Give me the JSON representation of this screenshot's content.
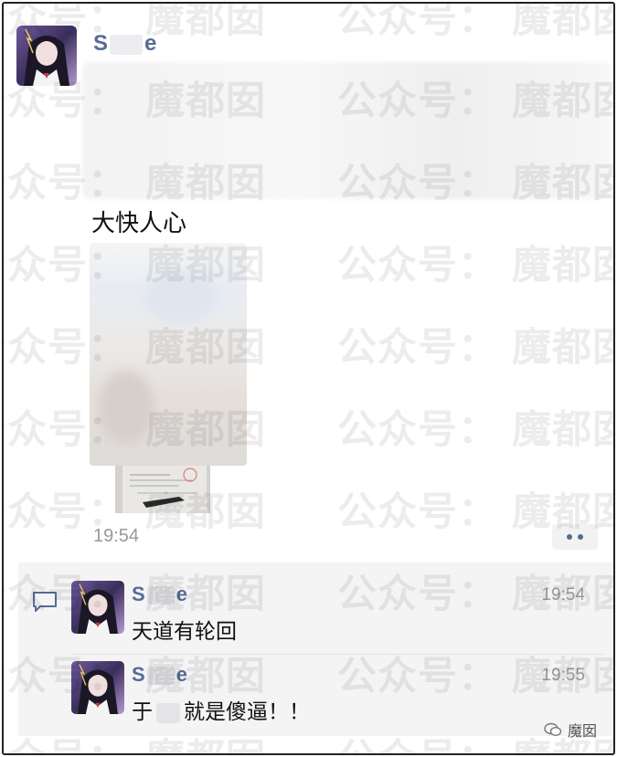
{
  "post": {
    "author_prefix": "S",
    "author_suffix": "e",
    "text": "大快人心",
    "time": "19:54",
    "more_icon": "ellipsis-icon"
  },
  "comments": [
    {
      "author_prefix": "S",
      "author_suffix": "e",
      "time": "19:54",
      "text": "天道有轮回",
      "text_prefix": "",
      "text_suffix": ""
    },
    {
      "author_prefix": "S",
      "author_suffix": "e",
      "time": "19:55",
      "text": "",
      "text_prefix": "于",
      "text_suffix": "就是傻逼！！"
    }
  ],
  "watermark": {
    "left": "公众号：",
    "right": "魔都囡"
  },
  "source_tag": "魔囡",
  "colors": {
    "name_blue": "#576b95",
    "time_gray": "#999999",
    "comment_bg": "#f4f4f4"
  }
}
